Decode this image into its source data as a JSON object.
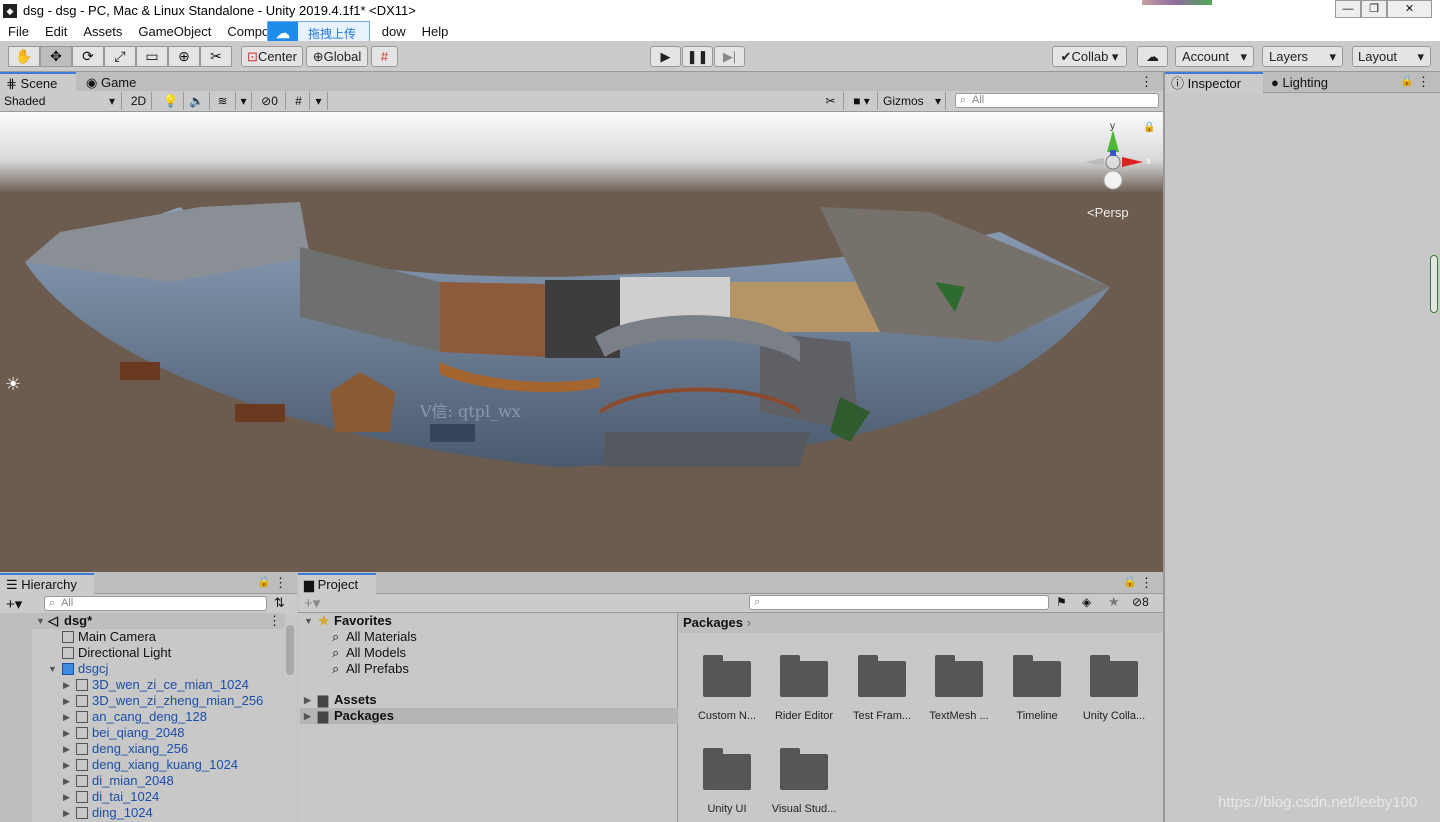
{
  "window": {
    "title": "dsg - dsg - PC, Mac & Linux Standalone - Unity 2019.4.1f1* <DX11>"
  },
  "menu": [
    "File",
    "Edit",
    "Assets",
    "GameObject",
    "Compone",
    "dow",
    "Help"
  ],
  "upload_popup": {
    "label": "拖拽上传"
  },
  "toolbar": {
    "pivot_label": "Center",
    "space_label": "Global",
    "collab_label": "Collab",
    "account_label": "Account",
    "layers_label": "Layers",
    "layout_label": "Layout"
  },
  "tabs": {
    "scene": "Scene",
    "game": "Game",
    "inspector": "Inspector",
    "lighting": "Lighting",
    "hierarchy": "Hierarchy",
    "project": "Project"
  },
  "scene_bar": {
    "shading_mode": "Shaded",
    "mode_2d": "2D",
    "hidden_count": "0",
    "gizmos_label": "Gizmos",
    "search_placeholder": "All"
  },
  "viewport": {
    "persp_label": "Persp",
    "gizmo_x": "x",
    "gizmo_y": "y",
    "watermark": "V信: qtpl_wx"
  },
  "hierarchy": {
    "search_placeholder": "All",
    "scene_name": "dsg*",
    "items": [
      {
        "label": "Main Camera",
        "level": 1,
        "blue": false
      },
      {
        "label": "Directional Light",
        "level": 1,
        "blue": false
      },
      {
        "label": "dsgcj",
        "level": 1,
        "blue": true
      },
      {
        "label": "3D_wen_zi_ce_mian_1024",
        "level": 2,
        "blue": true
      },
      {
        "label": "3D_wen_zi_zheng_mian_256",
        "level": 2,
        "blue": true
      },
      {
        "label": "an_cang_deng_128",
        "level": 2,
        "blue": true
      },
      {
        "label": "bei_qiang_2048",
        "level": 2,
        "blue": true
      },
      {
        "label": "deng_xiang_256",
        "level": 2,
        "blue": true
      },
      {
        "label": "deng_xiang_kuang_1024",
        "level": 2,
        "blue": true
      },
      {
        "label": "di_mian_2048",
        "level": 2,
        "blue": true
      },
      {
        "label": "di_tai_1024",
        "level": 2,
        "blue": true
      },
      {
        "label": "ding_1024",
        "level": 2,
        "blue": true
      }
    ]
  },
  "project": {
    "hidden_count": "8",
    "favorites_label": "Favorites",
    "favorites": [
      "All Materials",
      "All Models",
      "All Prefabs"
    ],
    "roots": [
      "Assets",
      "Packages"
    ],
    "breadcrumb": "Packages",
    "packages": [
      "Custom N...",
      "Rider Editor",
      "Test Fram...",
      "TextMesh ...",
      "Timeline",
      "Unity Colla...",
      "Unity UI",
      "Visual Stud..."
    ]
  },
  "footer_watermark": "https://blog.csdn.net/leeby100"
}
